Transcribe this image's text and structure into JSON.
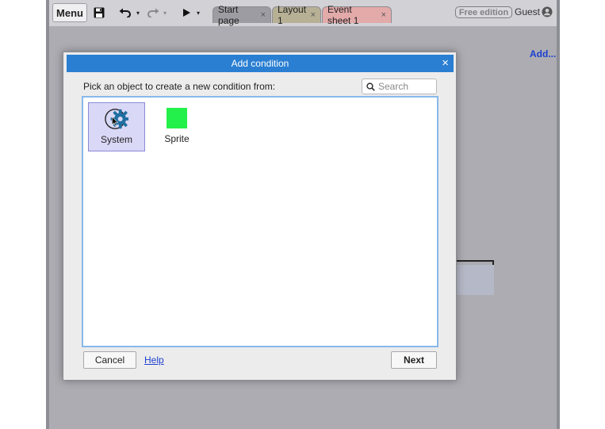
{
  "toolbar": {
    "menu_label": "Menu",
    "save_icon": "save-icon",
    "undo_icon": "undo-icon",
    "redo_icon": "redo-icon",
    "play_icon": "play-icon"
  },
  "tabs": [
    {
      "label": "Start page",
      "close": "×"
    },
    {
      "label": "Layout 1",
      "close": "×"
    },
    {
      "label": "Event sheet 1",
      "close": "×"
    }
  ],
  "account": {
    "edition_badge": "Free edition",
    "user_label": "Guest"
  },
  "sidebar": {
    "add_link": "Add..."
  },
  "dialog": {
    "title": "Add condition",
    "close_glyph": "×",
    "prompt": "Pick an object to create a new condition from:",
    "search_placeholder": "Search",
    "objects": [
      {
        "label": "System",
        "icon": "system-gear-icon",
        "selected": true
      },
      {
        "label": "Sprite",
        "icon": "sprite-icon",
        "selected": false,
        "color": "#23f04a"
      }
    ],
    "cancel_label": "Cancel",
    "help_label": "Help",
    "next_label": "Next"
  },
  "colors": {
    "title_bar": "#2a7fd2",
    "selection": "#d9d8f6",
    "link": "#1b3fcf"
  }
}
